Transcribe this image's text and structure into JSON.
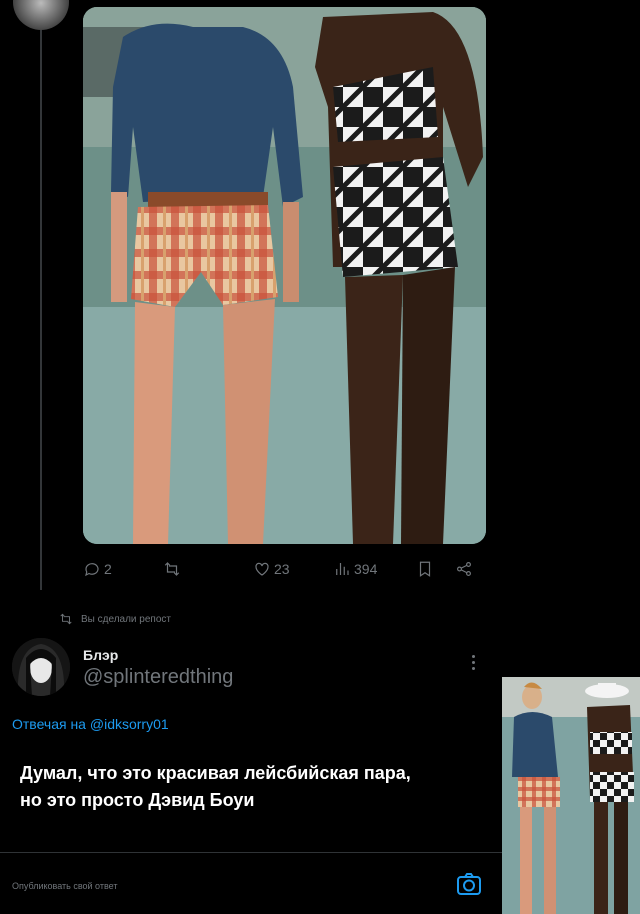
{
  "tweet": {
    "actions": {
      "replies": "2",
      "reposts": "",
      "likes": "23",
      "views": "394"
    }
  },
  "repost_note": "Вы сделали репост",
  "reply": {
    "name": "Блэр",
    "handle": "@splinteredthing",
    "replying_to_prefix": "Отвечая на ",
    "replying_to_handle": "@idksorry01",
    "text_line1": "Думал, что это красивая лейсбийская пара,",
    "text_line2": "но это просто Дэвид Боуи"
  },
  "composer": {
    "placeholder": "Опубликовать свой ответ"
  },
  "colors": {
    "accent": "#1d9bf0",
    "muted": "#71767b",
    "background": "#000000"
  },
  "icons": [
    "reply-icon",
    "repost-icon",
    "like-icon",
    "views-icon",
    "bookmark-icon",
    "share-icon",
    "more-icon",
    "camera-icon"
  ]
}
